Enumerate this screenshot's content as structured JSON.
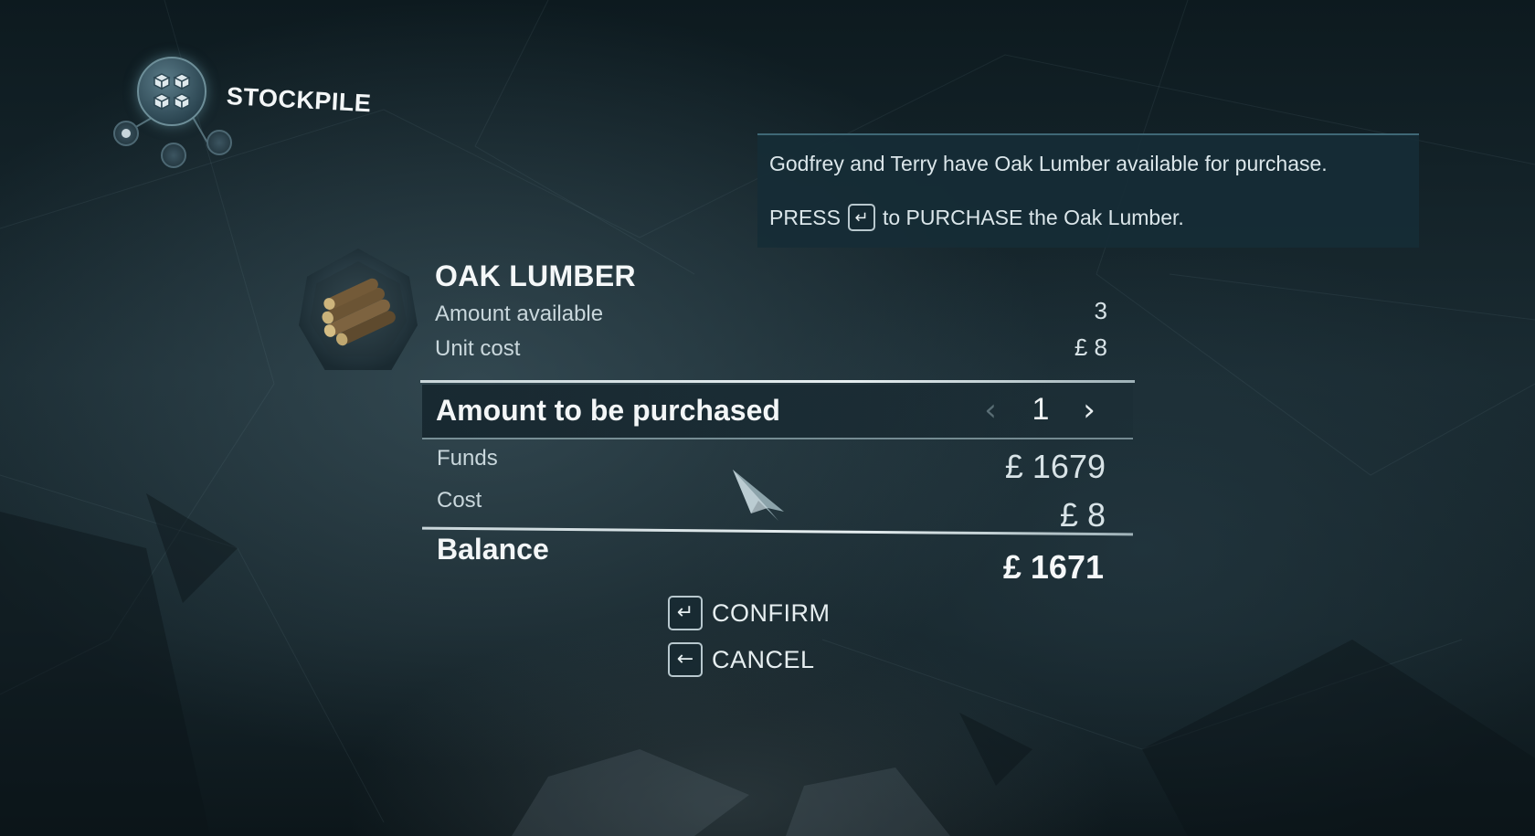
{
  "header": {
    "title": "STOCKPILE",
    "icon": "stockpile-hex-icon"
  },
  "tooltip": {
    "line1": "Godfrey and Terry have Oak Lumber available for purchase.",
    "line2_prefix": "PRESS",
    "line2_key_icon": "enter-key-icon",
    "line2_suffix": "to PURCHASE the Oak Lumber."
  },
  "item": {
    "name": "OAK LUMBER",
    "icon": "oak-lumber-logs-icon",
    "amount_available_label": "Amount available",
    "amount_available_value": "3",
    "unit_cost_label": "Unit cost",
    "unit_cost_value": "£ 8"
  },
  "purchase": {
    "label": "Amount to be purchased",
    "quantity": "1",
    "decrease_icon": "chevron-left-icon",
    "increase_icon": "chevron-right-icon"
  },
  "summary": {
    "funds_label": "Funds",
    "funds_value": "£ 1679",
    "cost_label": "Cost",
    "cost_value": "£ 8",
    "balance_label": "Balance",
    "balance_value": "£ 1671"
  },
  "actions": {
    "confirm_key": "↵",
    "confirm_label": "CONFIRM",
    "cancel_key": "←",
    "cancel_label": "CANCEL"
  },
  "colors": {
    "background": "#16252b",
    "tooltip_bg": "#162c36",
    "text_primary": "#f3f6f7",
    "text_secondary": "#c9d7dc"
  }
}
